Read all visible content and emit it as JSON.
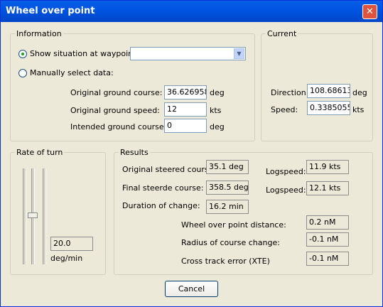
{
  "window": {
    "title": "Wheel over point",
    "close_glyph": "✕"
  },
  "information": {
    "legend": "Information",
    "radio_waypoint_label": "Show situation at waypoint:",
    "waypoint_value": "",
    "radio_manual_label": "Manually select data:",
    "orig_course_label": "Original ground course:",
    "orig_course_value": "36.6269586",
    "orig_course_unit": "deg",
    "orig_speed_label": "Original ground speed:",
    "orig_speed_value": "12",
    "orig_speed_unit": "kts",
    "intended_course_label": "Intended ground course:",
    "intended_course_value": "0",
    "intended_course_unit": "deg"
  },
  "current": {
    "legend": "Current",
    "direction_label": "Direction:",
    "direction_value": "108.686134",
    "direction_unit": "deg",
    "speed_label": "Speed:",
    "speed_value": "0.33850557",
    "speed_unit": "kts"
  },
  "rate_of_turn": {
    "legend": "Rate of turn",
    "value": "20.0",
    "unit": "deg/min"
  },
  "results": {
    "legend": "Results",
    "orig_steered_label": "Original steered course:",
    "orig_steered_value": "35.1 deg",
    "logspeed1_label": "Logspeed:",
    "logspeed1_value": "11.9 kts",
    "final_steered_label": "Final steerde course:",
    "final_steered_value": "358.5 deg",
    "logspeed2_label": "Logspeed:",
    "logspeed2_value": "12.1 kts",
    "duration_label": "Duration of change:",
    "duration_value": "16.2 min",
    "wop_distance_label": "Wheel over point distance:",
    "wop_distance_value": "0.2 nM",
    "radius_label": "Radius of course change:",
    "radius_value": "-0.1 nM",
    "xte_label": "Cross track error (XTE)",
    "xte_value": "-0.1 nM"
  },
  "buttons": {
    "cancel": "Cancel"
  },
  "icons": {
    "dropdown": "chevron-down-icon",
    "close": "close-icon"
  },
  "colors": {
    "titlebar": "#0054e3",
    "close": "#e0533e",
    "background": "#ece9d8"
  }
}
